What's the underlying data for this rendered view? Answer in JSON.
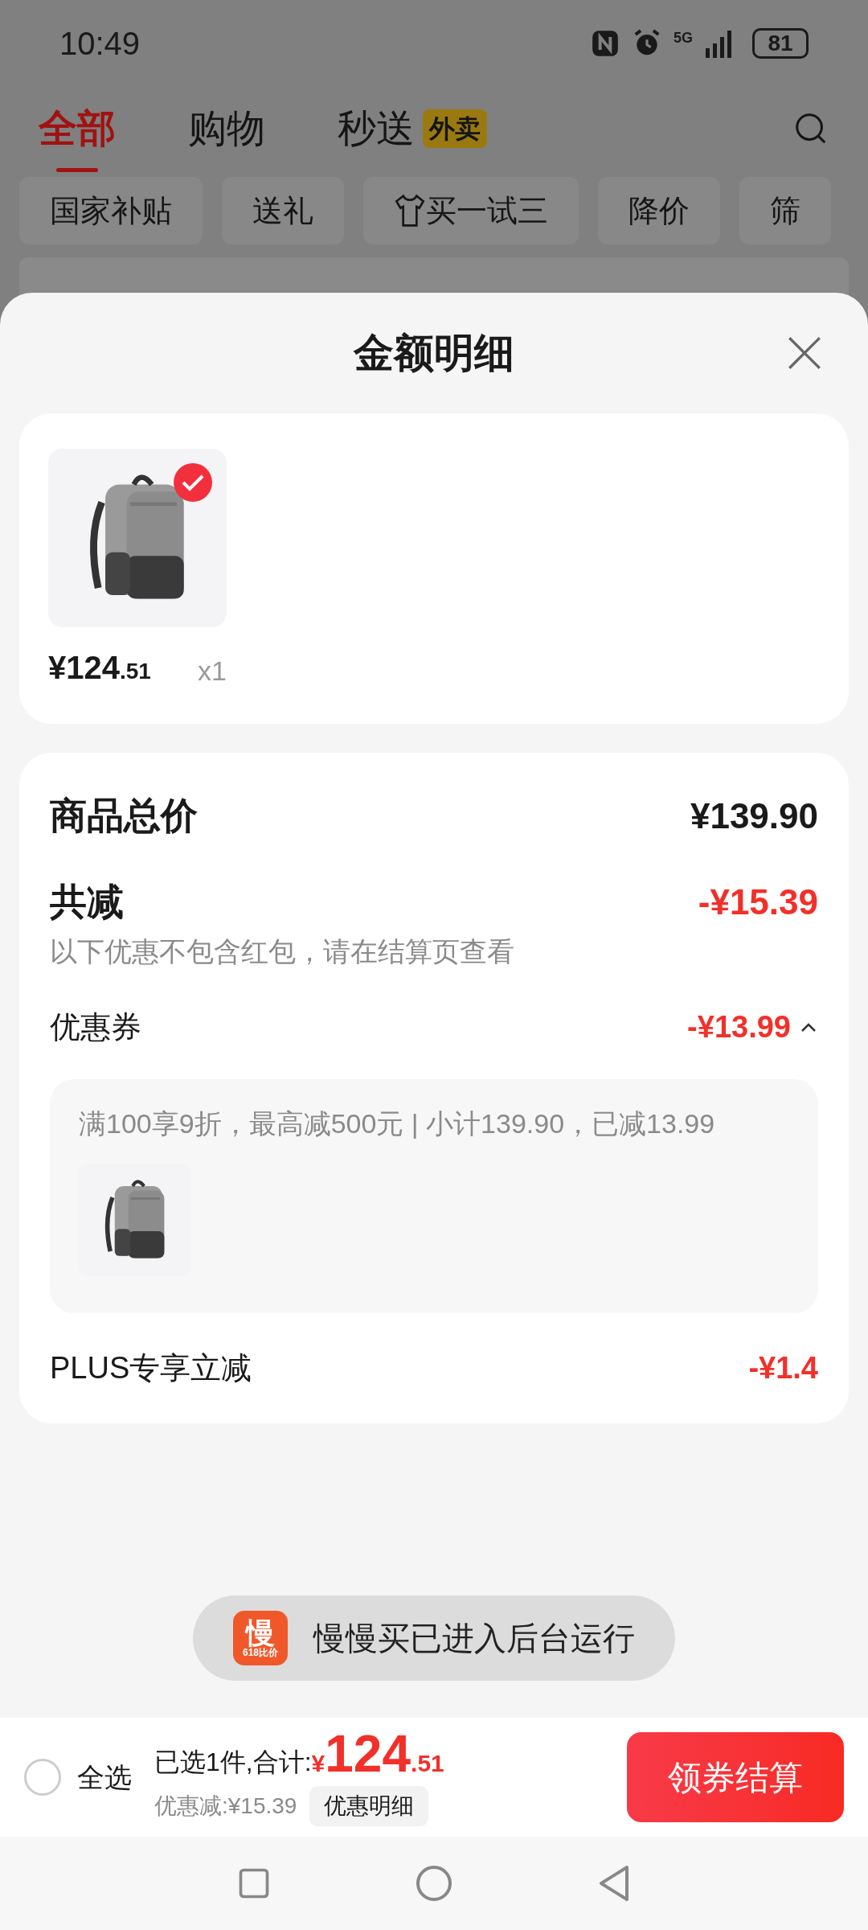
{
  "status_bar": {
    "time": "10:49",
    "network": "5G",
    "battery": "81"
  },
  "tabs": [
    {
      "label": "全部",
      "selected": true
    },
    {
      "label": "购物",
      "selected": false
    },
    {
      "label": "秒送",
      "selected": false,
      "badge": "外卖"
    }
  ],
  "chips": [
    {
      "label": "国家补贴",
      "kind": "plain"
    },
    {
      "label": "送礼",
      "kind": "plain"
    },
    {
      "label": "买一试三",
      "kind": "shirt"
    },
    {
      "label": "降价",
      "kind": "plain"
    },
    {
      "label": "筛",
      "kind": "plain"
    }
  ],
  "sheet": {
    "title": "金额明细"
  },
  "items": [
    {
      "checked": true,
      "price_main": "¥124",
      "price_decimal": ".51",
      "quantity": "x1"
    }
  ],
  "summary": {
    "total_label": "商品总价",
    "total_value": "¥139.90",
    "discount_label": "共减",
    "discount_value": "-¥15.39",
    "discount_note": "以下优惠不包含红包，请在结算页查看"
  },
  "discounts": [
    {
      "label": "优惠券",
      "value": "-¥13.99",
      "expanded": true,
      "detail": "满100享9折，最高减500元 | 小计139.90，已减13.99"
    },
    {
      "label": "PLUS专享立减",
      "value": "-¥1.4"
    }
  ],
  "toast": {
    "app_icon_glyph": "慢",
    "app_icon_caption": "618比价",
    "text": "慢慢买已进入后台运行"
  },
  "bottom_bar": {
    "select_all_label": "全选",
    "select_all_checked": false,
    "selected_text": "已选1件,合计:",
    "currency": "¥",
    "total_main": "124",
    "total_decimal": ".51",
    "saving": "优惠减:¥15.39",
    "detail_button": "优惠明细",
    "checkout_button": "领券结算"
  }
}
